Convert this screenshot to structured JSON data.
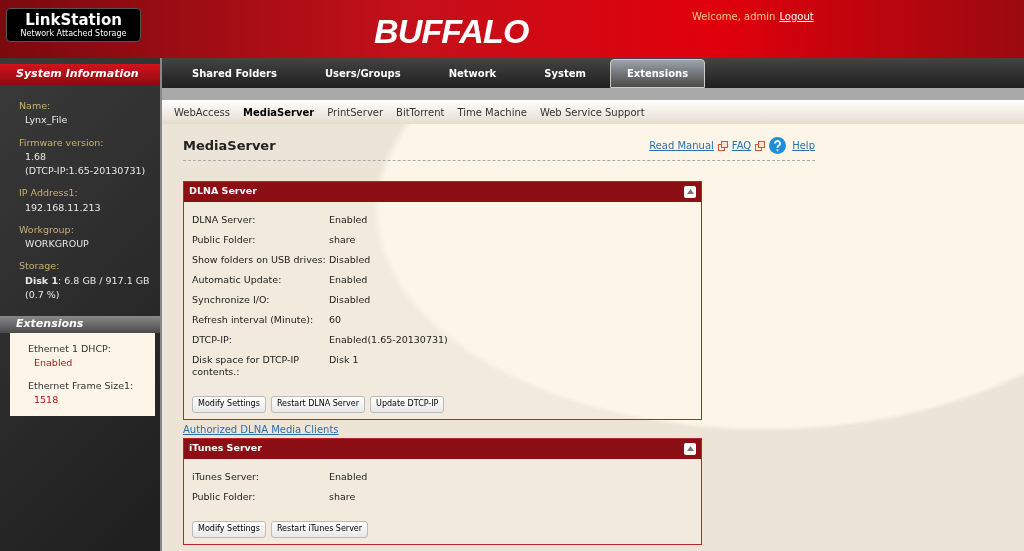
{
  "header": {
    "product": "LinkStation",
    "product_subtitle": "Network Attached Storage",
    "brand": "BUFFALO",
    "welcome": "Welcome, admin",
    "logout": "Logout"
  },
  "main_tabs": [
    {
      "label": "Shared Folders",
      "selected": false
    },
    {
      "label": "Users/Groups",
      "selected": false
    },
    {
      "label": "Network",
      "selected": false
    },
    {
      "label": "System",
      "selected": false
    },
    {
      "label": "Extensions",
      "selected": true
    }
  ],
  "sub_tabs": [
    {
      "label": "WebAccess",
      "selected": false
    },
    {
      "label": "MediaServer",
      "selected": true
    },
    {
      "label": "PrintServer",
      "selected": false
    },
    {
      "label": "BitTorrent",
      "selected": false
    },
    {
      "label": "Time Machine",
      "selected": false
    },
    {
      "label": "Web Service Support",
      "selected": false
    }
  ],
  "sidebar": {
    "system_title": "System Information",
    "info": [
      {
        "label": "Name:",
        "value": "Lynx_File"
      },
      {
        "label": "Firmware version:",
        "value": "1.68",
        "value_2": "(DTCP-IP:1.65-20130731)"
      },
      {
        "label": "IP Address1:",
        "value": "192.168.11.213"
      },
      {
        "label": "Workgroup:",
        "value": "WORKGROUP"
      },
      {
        "label": "Storage:",
        "value": "**Disk 1**: 6.8 GB / 917.1 GB (0.7 %)"
      }
    ],
    "extensions_title": "Extensions",
    "extensions": [
      {
        "label": "Ethernet 1 DHCP:",
        "value": "Enabled"
      },
      {
        "label": "Ethernet Frame Size1:",
        "value": "1518"
      }
    ]
  },
  "page": {
    "title": "MediaServer",
    "links": [
      "Read Manual",
      "FAQ",
      "Help"
    ],
    "panels": [
      {
        "title": "DLNA Server",
        "rows": [
          {
            "label": "DLNA Server:",
            "value": "Enabled"
          },
          {
            "label": "Public Folder:",
            "value": "share"
          },
          {
            "label": "Show folders on USB drives:",
            "value": "Disabled"
          },
          {
            "label": "Automatic Update:",
            "value": "Enabled"
          },
          {
            "label": "Synchronize I/O:",
            "value": "Disabled"
          },
          {
            "label": "Refresh interval (Minute):",
            "value": "60"
          },
          {
            "label": "DTCP-IP:",
            "value": "Enabled(1.65-20130731)"
          },
          {
            "label": "Disk space for DTCP-IP contents.:",
            "value": "Disk 1"
          }
        ],
        "buttons": [
          "Modify Settings",
          "Restart DLNA Server",
          "Update DTCP-IP"
        ],
        "link_below": "Authorized DLNA Media Clients"
      },
      {
        "title": "iTunes Server",
        "rows": [
          {
            "label": "iTunes Server:",
            "value": "Enabled"
          },
          {
            "label": "Public Folder:",
            "value": "share"
          }
        ],
        "buttons": [
          "Modify Settings",
          "Restart iTunes Server"
        ]
      }
    ]
  }
}
